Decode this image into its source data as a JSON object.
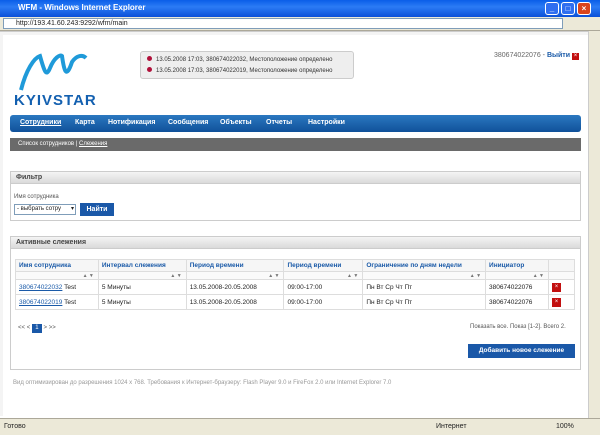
{
  "window": {
    "title": "WFM - Windows Internet Explorer",
    "url": "http://193.41.60.243:9292/wfm/main"
  },
  "brand": {
    "logo_text": "KYIVSTAR"
  },
  "notifications": [
    "13.05.2008 17:03, 380674022032, Местоположение определено",
    "13.05.2008 17:03, 380674022019, Местоположение определено"
  ],
  "user": {
    "phone": "380674022076",
    "logout": "Выйти"
  },
  "nav": [
    "Сотрудники",
    "Карта",
    "Нотификация",
    "Сообщения",
    "Объекты",
    "Отчеты",
    "Настройки"
  ],
  "subnav": {
    "item1": "Список сотрудников",
    "item2": "Слежения"
  },
  "filter": {
    "title": "Фильтр",
    "label": "Имя сотрудника",
    "select": "- выбрать сотру",
    "find": "Найти"
  },
  "tracking": {
    "title": "Активные слежения",
    "headers": [
      "Имя сотрудника",
      "Интервал слежения",
      "Период времени",
      "Период времени",
      "Ограничение по дням недели",
      "Инициатор"
    ],
    "rows": [
      {
        "phone": "380674022032",
        "name": "Test",
        "interval": "5 Минуты",
        "period": "13.05.2008-20.05.2008",
        "time": "09:00-17:00",
        "days": "Пн Вт Ср Чт Пт",
        "init": "380674022076"
      },
      {
        "phone": "380674022019",
        "name": "Test",
        "interval": "5 Минуты",
        "period": "13.05.2008-20.05.2008",
        "time": "09:00-17:00",
        "days": "Пн Вт Ср Чт Пт",
        "init": "380674022076"
      }
    ],
    "show_all": "Показать все.",
    "count": "Показ [1-2]. Всего 2.",
    "add": "Добавить новое слежение",
    "page": "1"
  },
  "footer": "Вид оптимизирован до разрешения 1024 x 768. Требования к Интернет-браузеру: Flash Player 9.0 и FireFox 2.0 или Internet Explorer 7.0",
  "statusbar": {
    "ready": "Готово",
    "zone": "Интернет",
    "zoom": "100%"
  }
}
